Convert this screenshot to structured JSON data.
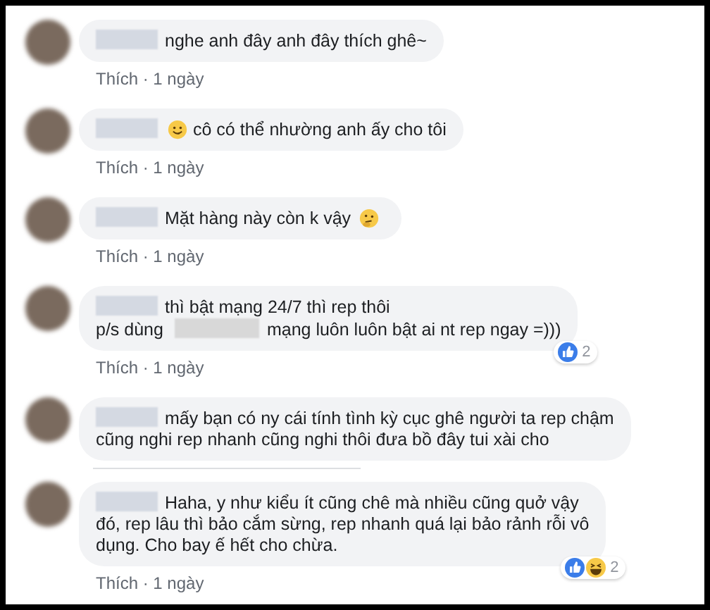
{
  "comments": [
    {
      "segments": [
        {
          "kind": "blur"
        },
        {
          "kind": "text",
          "text": "nghe anh đây anh đây thích ghê~"
        }
      ],
      "meta": "Thích · 1 ngày"
    },
    {
      "segments": [
        {
          "kind": "blur"
        },
        {
          "kind": "smile"
        },
        {
          "kind": "text",
          "text": "cô có thể nhường anh ấy cho tôi"
        }
      ],
      "meta": "Thích · 1 ngày"
    },
    {
      "segments": [
        {
          "kind": "blur"
        },
        {
          "kind": "text",
          "text": "Mặt hàng này còn k vậy"
        },
        {
          "kind": "thinking"
        }
      ],
      "meta": "Thích · 1 ngày"
    },
    {
      "segments": [
        {
          "kind": "blur"
        },
        {
          "kind": "text",
          "text": "thì bật mạng 24/7 thì rep thôi"
        },
        {
          "kind": "break"
        },
        {
          "kind": "text",
          "text": "p/s dùng"
        },
        {
          "kind": "blur"
        },
        {
          "kind": "text",
          "text": "mạng luôn luôn bật ai nt rep ngay =)))"
        }
      ],
      "reactions": [
        {
          "kind": "like"
        }
      ],
      "reaction_count": "2",
      "meta": "Thích · 1 ngày"
    },
    {
      "segments": [
        {
          "kind": "blur"
        },
        {
          "kind": "text",
          "text": "mấy bạn có ny cái tính tình kỳ cục ghê người ta rep chậm"
        },
        {
          "kind": "break"
        },
        {
          "kind": "text",
          "text": "cũng nghi rep nhanh cũng nghi thôi đưa bồ đây tui xài cho"
        }
      ]
    },
    {
      "segments": [
        {
          "kind": "blur"
        },
        {
          "kind": "text",
          "text": "Haha, y như kiểu ít cũng chê mà nhiều cũng quở vậy"
        },
        {
          "kind": "break"
        },
        {
          "kind": "text",
          "text": "đó, rep lâu thì bảo cắm sừng, rep nhanh quá lại bảo rảnh rỗi vô"
        },
        {
          "kind": "break"
        },
        {
          "kind": "text",
          "text": "dụng. Cho bay ế hết cho chừa."
        }
      ],
      "reactions": [
        {
          "kind": "like"
        },
        {
          "kind": "haha"
        }
      ],
      "reaction_count": "2",
      "meta": "Thích · 1 ngày"
    }
  ]
}
